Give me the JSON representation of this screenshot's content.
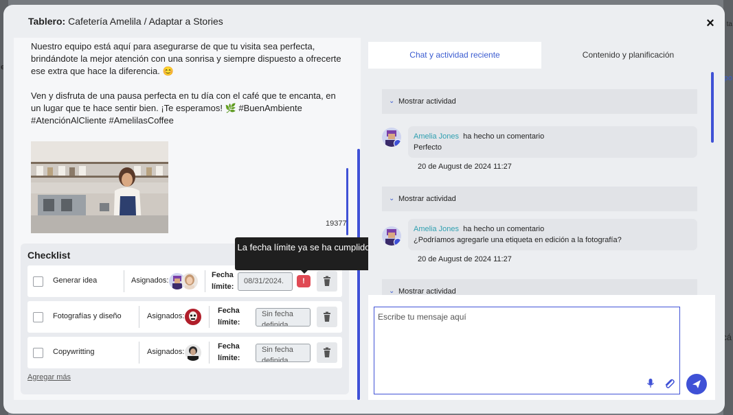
{
  "header": {
    "title_prefix": "Tablero:",
    "title_rest": "Cafetería Amelila / Adaptar a Stories",
    "close_label": "×"
  },
  "post": {
    "paragraph1": "Nuestro equipo está aquí para asegurarse de que tu visita sea perfecta, brindándote la mejor atención con una sonrisa y siempre dispuesto a ofrecerte ese extra que hace la diferencia. 😊",
    "paragraph2": "Ven y disfruta de una pausa perfecta en tu día con el café que te encanta, en un lugar que te hace sentir bien. ¡Te esperamos! 🌿 #BuenAmbiente #AtenciónAlCliente #AmelilasCoffee",
    "char_count": "19377"
  },
  "checklist": {
    "title": "Checklist",
    "add_more": "Agregar más",
    "assigned_label": "Asignados:",
    "due_label_1": "Fecha",
    "due_label_2": "límite:",
    "items": [
      {
        "name": "Generar idea",
        "due": "08/31/2024.",
        "overdue": true
      },
      {
        "name": "Fotografías y diseño",
        "due": "Sin fecha definida",
        "overdue": false
      },
      {
        "name": "Copywritting",
        "due": "Sin fecha definida",
        "overdue": false
      }
    ],
    "warn_glyph": "!"
  },
  "tooltip": {
    "text": "La fecha límite ya se ha cumplido"
  },
  "tabs": {
    "chat": "Chat y actividad reciente",
    "content": "Contenido y planificación"
  },
  "activity": {
    "show_label": "Mostrar actividad",
    "comments": [
      {
        "author": "Amelia Jones",
        "action": "ha hecho un comentario",
        "text": "Perfecto",
        "date": "20 de August de 2024 11:27"
      },
      {
        "author": "Amelia Jones",
        "action": "ha hecho un comentario",
        "text": "¿Podríamos agregarle una etiqueta en edición a la fotografía?",
        "date": "20 de August de 2024 11:27"
      }
    ]
  },
  "composer": {
    "placeholder": "Escribe tu mensaje aquí"
  },
  "backdrop": {
    "frag1": "ta",
    "frag2": "e",
    "frag3": "po",
    "frag4": "cá"
  },
  "colors": {
    "accent": "#3f51d6",
    "danger": "#e04a54",
    "author": "#2f9fb0",
    "tooltip_bg": "#1f1f1f"
  }
}
